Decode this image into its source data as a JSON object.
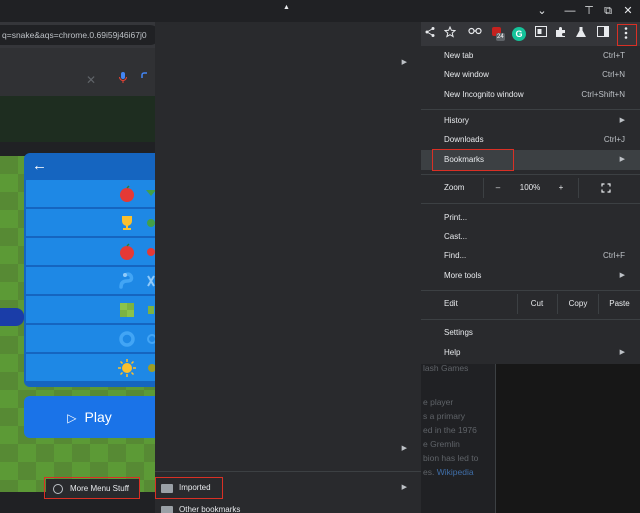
{
  "titlebar": {
    "minimize_glyph": "—",
    "pin_glyph": "⊤",
    "restore_glyph": "⧉",
    "close_glyph": "✕",
    "dropdown_glyph": "⌄"
  },
  "omnibox": {
    "url_fragment": "q=snake&aqs=chrome.0.69i59j46i67j0"
  },
  "toolbar": {
    "badge_count": "24",
    "grammarly_letter": "G"
  },
  "game": {
    "back_arrow": "←",
    "play_label": "Play",
    "play_icon": "▷"
  },
  "context_menu": {
    "more_menu_stuff": "More Menu Stuff"
  },
  "bookmarks_menu": {
    "scroll_up": "▲",
    "items": [
      {
        "label": "Imported"
      },
      {
        "label": "Other bookmarks"
      }
    ]
  },
  "main_menu": {
    "items": {
      "new_tab": {
        "label": "New tab",
        "shortcut": "Ctrl+T"
      },
      "new_window": {
        "label": "New window",
        "shortcut": "Ctrl+N"
      },
      "new_incognito": {
        "label": "New Incognito window",
        "shortcut": "Ctrl+Shift+N"
      },
      "history": {
        "label": "History"
      },
      "downloads": {
        "label": "Downloads",
        "shortcut": "Ctrl+J"
      },
      "bookmarks": {
        "label": "Bookmarks"
      },
      "print": {
        "label": "Print..."
      },
      "cast": {
        "label": "Cast..."
      },
      "find": {
        "label": "Find...",
        "shortcut": "Ctrl+F"
      },
      "more_tools": {
        "label": "More tools"
      },
      "settings": {
        "label": "Settings"
      },
      "help": {
        "label": "Help"
      }
    },
    "zoom": {
      "label": "Zoom",
      "minus": "–",
      "value": "100%",
      "plus": "+"
    },
    "edit": {
      "label": "Edit",
      "cut": "Cut",
      "copy": "Copy",
      "paste": "Paste"
    }
  },
  "background_page": {
    "lines": [
      "lash Games",
      "",
      "e player",
      "s a primary",
      "ed in the 1976",
      "e Gremlin",
      "bion has led to",
      "es."
    ],
    "wiki_link": "Wikipedia"
  },
  "colors": {
    "accent_red": "#d93025",
    "menu_bg": "#292a2d",
    "game_blue": "#1a73e8"
  }
}
